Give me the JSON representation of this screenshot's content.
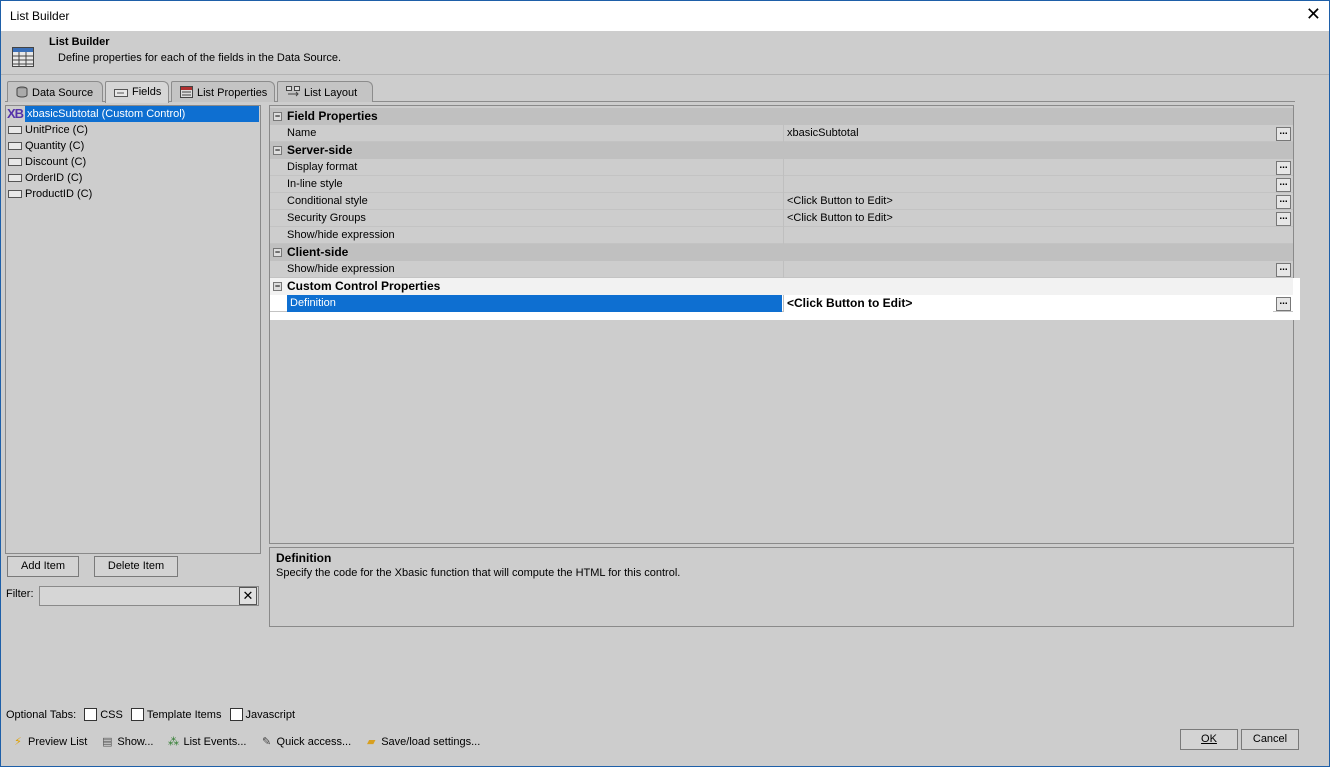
{
  "window": {
    "title": "List Builder",
    "close_glyph": "✕"
  },
  "header": {
    "title": "List Builder",
    "description": "Define properties for each of the fields in the Data Source."
  },
  "tabs": [
    {
      "label": "Data Source",
      "icon": "database-icon"
    },
    {
      "label": "Fields",
      "icon": "field-icon",
      "active": true
    },
    {
      "label": "List Properties",
      "icon": "properties-icon"
    },
    {
      "label": "List Layout",
      "icon": "layout-icon"
    }
  ],
  "fields": [
    {
      "label": "xbasicSubtotal (Custom Control)",
      "icon_text": "XB",
      "selected": true
    },
    {
      "label": "UnitPrice (C)"
    },
    {
      "label": "Quantity (C)"
    },
    {
      "label": "Discount (C)"
    },
    {
      "label": "OrderID (C)"
    },
    {
      "label": "ProductID (C)"
    }
  ],
  "buttons": {
    "add_item": "Add Item",
    "delete_item": "Delete Item",
    "ok": "OK",
    "cancel": "Cancel",
    "ellipsis": "..."
  },
  "filter": {
    "label": "Filter:",
    "value": "",
    "clear_glyph": "✕"
  },
  "properties": {
    "field_properties": {
      "title": "Field Properties",
      "name_label": "Name",
      "name_value": "xbasicSubtotal"
    },
    "server_side": {
      "title": "Server-side",
      "display_format": "Display format",
      "inline_style": "In-line style",
      "conditional_style": "Conditional style",
      "conditional_style_value": "<Click Button to Edit>",
      "security_groups": "Security Groups",
      "security_groups_value": "<Click Button to Edit>",
      "show_hide": "Show/hide expression"
    },
    "client_side": {
      "title": "Client-side",
      "show_hide": "Show/hide expression"
    },
    "custom_control": {
      "title": "Custom Control Properties",
      "definition": "Definition",
      "definition_value": "<Click Button to Edit>"
    }
  },
  "description": {
    "title": "Definition",
    "text": "Specify the code for the Xbasic function that will compute the HTML for this control."
  },
  "optional_tabs": {
    "label": "Optional Tabs:",
    "items": [
      "CSS",
      "Template Items",
      "Javascript"
    ]
  },
  "toolbar": [
    {
      "label": "Preview List",
      "icon": "lightning-icon"
    },
    {
      "label": "Show...",
      "icon": "window-icon"
    },
    {
      "label": "List Events...",
      "icon": "events-icon"
    },
    {
      "label": "Quick access...",
      "icon": "wrench-icon"
    },
    {
      "label": "Save/load settings...",
      "icon": "folder-icon"
    }
  ],
  "colors": {
    "selection": "#0e6fd1",
    "window_bg": "#cdcdcd"
  }
}
